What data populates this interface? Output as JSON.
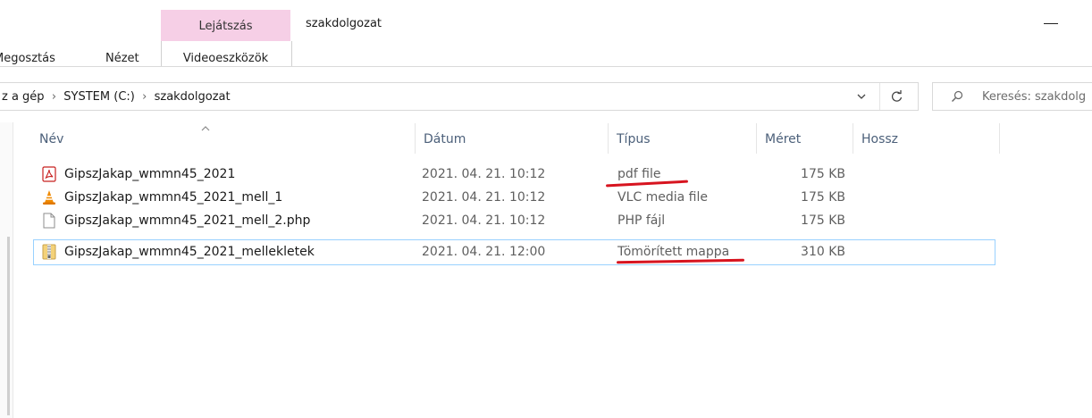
{
  "ribbon": {
    "context_tab_group": "Lejátszás",
    "window_title": "szakdolgozat",
    "tabs": [
      {
        "label": "Megosztás"
      },
      {
        "label": "Nézet"
      },
      {
        "label": "Videoeszközök"
      }
    ]
  },
  "address_bar": {
    "breadcrumbs": [
      "z a gép",
      "SYSTEM (C:)",
      "szakdolgozat"
    ],
    "separator": "›"
  },
  "search": {
    "placeholder": "Keresés: szakdolg"
  },
  "columns": {
    "name": "Név",
    "date": "Dátum",
    "type": "Típus",
    "size": "Méret",
    "length": "Hossz"
  },
  "files": [
    {
      "name": "GipszJakap_wmmn45_2021",
      "date": "2021. 04. 21. 10:12",
      "type": "pdf file",
      "size": "175 KB",
      "icon": "pdf-icon"
    },
    {
      "name": "GipszJakap_wmmn45_2021_mell_1",
      "date": "2021. 04. 21. 10:12",
      "type": "VLC media file",
      "size": "175 KB",
      "icon": "vlc-cone-icon"
    },
    {
      "name": "GipszJakap_wmmn45_2021_mell_2.php",
      "date": "2021. 04. 21. 10:12",
      "type": "PHP fájl",
      "size": "175 KB",
      "icon": "blank-file-icon"
    },
    {
      "name": "GipszJakap_wmmn45_2021_mellekletek",
      "date": "2021. 04. 21. 12:00",
      "type": "Tömörített mappa",
      "size": "310 KB",
      "icon": "zip-folder-icon",
      "selected": true
    }
  ],
  "colors": {
    "context_tab": "#f6cfe6",
    "selection_border": "#99d1ff",
    "annotation_underline": "#d7141f",
    "header_text": "#4c607a"
  }
}
